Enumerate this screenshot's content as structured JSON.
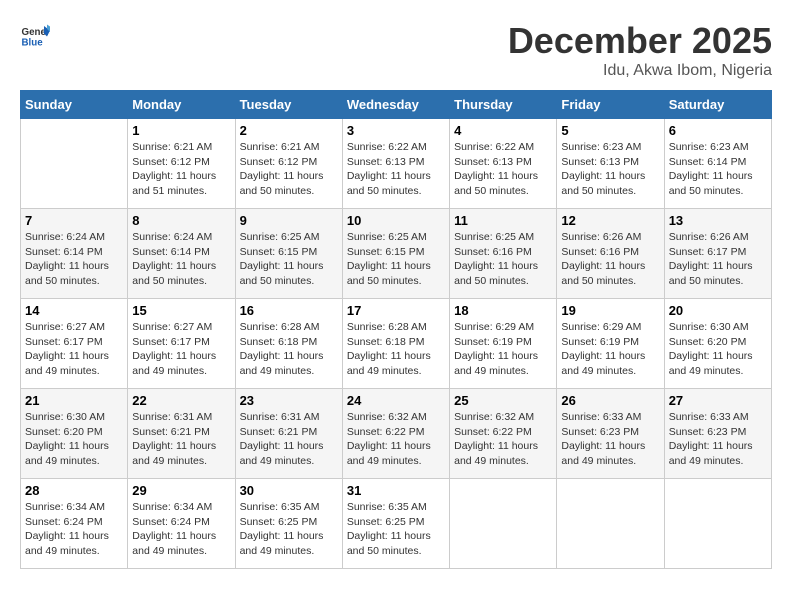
{
  "logo": {
    "text_general": "General",
    "text_blue": "Blue"
  },
  "header": {
    "month_year": "December 2025",
    "location": "Idu, Akwa Ibom, Nigeria"
  },
  "days_of_week": [
    "Sunday",
    "Monday",
    "Tuesday",
    "Wednesday",
    "Thursday",
    "Friday",
    "Saturday"
  ],
  "weeks": [
    [
      {
        "day": "",
        "info": ""
      },
      {
        "day": "1",
        "info": "Sunrise: 6:21 AM\nSunset: 6:12 PM\nDaylight: 11 hours\nand 51 minutes."
      },
      {
        "day": "2",
        "info": "Sunrise: 6:21 AM\nSunset: 6:12 PM\nDaylight: 11 hours\nand 50 minutes."
      },
      {
        "day": "3",
        "info": "Sunrise: 6:22 AM\nSunset: 6:13 PM\nDaylight: 11 hours\nand 50 minutes."
      },
      {
        "day": "4",
        "info": "Sunrise: 6:22 AM\nSunset: 6:13 PM\nDaylight: 11 hours\nand 50 minutes."
      },
      {
        "day": "5",
        "info": "Sunrise: 6:23 AM\nSunset: 6:13 PM\nDaylight: 11 hours\nand 50 minutes."
      },
      {
        "day": "6",
        "info": "Sunrise: 6:23 AM\nSunset: 6:14 PM\nDaylight: 11 hours\nand 50 minutes."
      }
    ],
    [
      {
        "day": "7",
        "info": "Sunrise: 6:24 AM\nSunset: 6:14 PM\nDaylight: 11 hours\nand 50 minutes."
      },
      {
        "day": "8",
        "info": "Sunrise: 6:24 AM\nSunset: 6:14 PM\nDaylight: 11 hours\nand 50 minutes."
      },
      {
        "day": "9",
        "info": "Sunrise: 6:25 AM\nSunset: 6:15 PM\nDaylight: 11 hours\nand 50 minutes."
      },
      {
        "day": "10",
        "info": "Sunrise: 6:25 AM\nSunset: 6:15 PM\nDaylight: 11 hours\nand 50 minutes."
      },
      {
        "day": "11",
        "info": "Sunrise: 6:25 AM\nSunset: 6:16 PM\nDaylight: 11 hours\nand 50 minutes."
      },
      {
        "day": "12",
        "info": "Sunrise: 6:26 AM\nSunset: 6:16 PM\nDaylight: 11 hours\nand 50 minutes."
      },
      {
        "day": "13",
        "info": "Sunrise: 6:26 AM\nSunset: 6:17 PM\nDaylight: 11 hours\nand 50 minutes."
      }
    ],
    [
      {
        "day": "14",
        "info": "Sunrise: 6:27 AM\nSunset: 6:17 PM\nDaylight: 11 hours\nand 49 minutes."
      },
      {
        "day": "15",
        "info": "Sunrise: 6:27 AM\nSunset: 6:17 PM\nDaylight: 11 hours\nand 49 minutes."
      },
      {
        "day": "16",
        "info": "Sunrise: 6:28 AM\nSunset: 6:18 PM\nDaylight: 11 hours\nand 49 minutes."
      },
      {
        "day": "17",
        "info": "Sunrise: 6:28 AM\nSunset: 6:18 PM\nDaylight: 11 hours\nand 49 minutes."
      },
      {
        "day": "18",
        "info": "Sunrise: 6:29 AM\nSunset: 6:19 PM\nDaylight: 11 hours\nand 49 minutes."
      },
      {
        "day": "19",
        "info": "Sunrise: 6:29 AM\nSunset: 6:19 PM\nDaylight: 11 hours\nand 49 minutes."
      },
      {
        "day": "20",
        "info": "Sunrise: 6:30 AM\nSunset: 6:20 PM\nDaylight: 11 hours\nand 49 minutes."
      }
    ],
    [
      {
        "day": "21",
        "info": "Sunrise: 6:30 AM\nSunset: 6:20 PM\nDaylight: 11 hours\nand 49 minutes."
      },
      {
        "day": "22",
        "info": "Sunrise: 6:31 AM\nSunset: 6:21 PM\nDaylight: 11 hours\nand 49 minutes."
      },
      {
        "day": "23",
        "info": "Sunrise: 6:31 AM\nSunset: 6:21 PM\nDaylight: 11 hours\nand 49 minutes."
      },
      {
        "day": "24",
        "info": "Sunrise: 6:32 AM\nSunset: 6:22 PM\nDaylight: 11 hours\nand 49 minutes."
      },
      {
        "day": "25",
        "info": "Sunrise: 6:32 AM\nSunset: 6:22 PM\nDaylight: 11 hours\nand 49 minutes."
      },
      {
        "day": "26",
        "info": "Sunrise: 6:33 AM\nSunset: 6:23 PM\nDaylight: 11 hours\nand 49 minutes."
      },
      {
        "day": "27",
        "info": "Sunrise: 6:33 AM\nSunset: 6:23 PM\nDaylight: 11 hours\nand 49 minutes."
      }
    ],
    [
      {
        "day": "28",
        "info": "Sunrise: 6:34 AM\nSunset: 6:24 PM\nDaylight: 11 hours\nand 49 minutes."
      },
      {
        "day": "29",
        "info": "Sunrise: 6:34 AM\nSunset: 6:24 PM\nDaylight: 11 hours\nand 49 minutes."
      },
      {
        "day": "30",
        "info": "Sunrise: 6:35 AM\nSunset: 6:25 PM\nDaylight: 11 hours\nand 49 minutes."
      },
      {
        "day": "31",
        "info": "Sunrise: 6:35 AM\nSunset: 6:25 PM\nDaylight: 11 hours\nand 50 minutes."
      },
      {
        "day": "",
        "info": ""
      },
      {
        "day": "",
        "info": ""
      },
      {
        "day": "",
        "info": ""
      }
    ]
  ]
}
